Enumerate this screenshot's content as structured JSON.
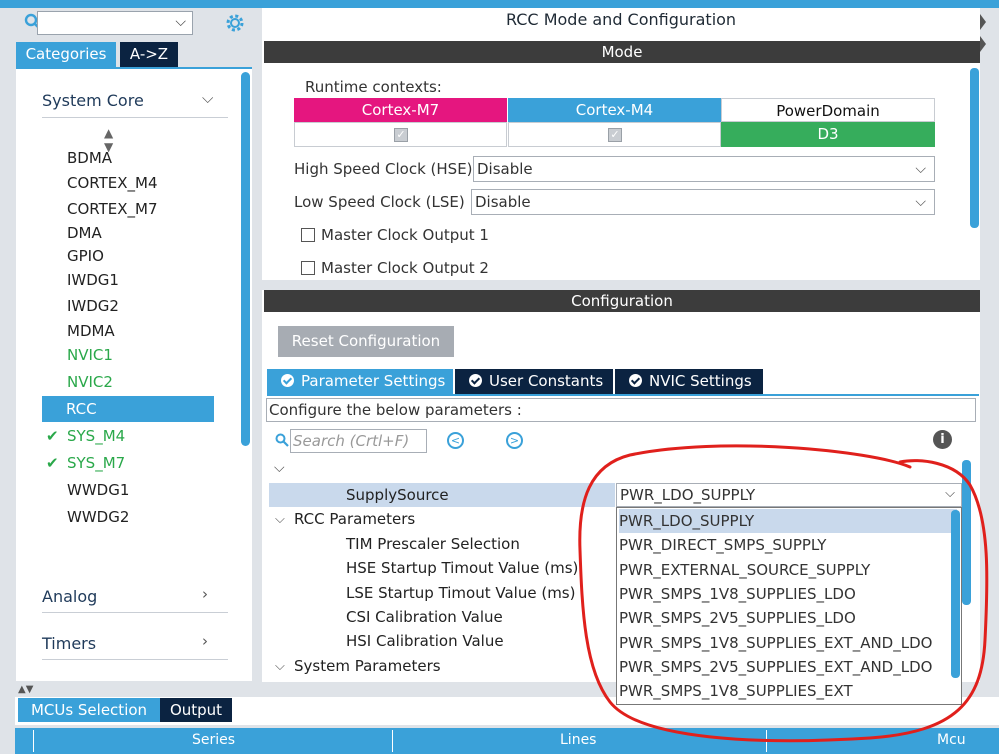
{
  "left_panel": {
    "search_placeholder": "",
    "tabs": {
      "categories": "Categories",
      "az": "A->Z"
    },
    "system_core": "System Core",
    "items": [
      {
        "label": "BDMA",
        "style": "normal"
      },
      {
        "label": "CORTEX_M4",
        "style": "normal"
      },
      {
        "label": "CORTEX_M7",
        "style": "normal"
      },
      {
        "label": "DMA",
        "style": "normal"
      },
      {
        "label": "GPIO",
        "style": "normal"
      },
      {
        "label": "IWDG1",
        "style": "normal"
      },
      {
        "label": "IWDG2",
        "style": "normal"
      },
      {
        "label": "MDMA",
        "style": "normal"
      },
      {
        "label": "NVIC1",
        "style": "green"
      },
      {
        "label": "NVIC2",
        "style": "green"
      },
      {
        "label": "RCC",
        "style": "selected"
      },
      {
        "label": "SYS_M4",
        "style": "green-check"
      },
      {
        "label": "SYS_M7",
        "style": "green-check"
      },
      {
        "label": "WWDG1",
        "style": "normal"
      },
      {
        "label": "WWDG2",
        "style": "normal"
      }
    ],
    "analog": "Analog",
    "timers": "Timers"
  },
  "bottom": {
    "tabs": {
      "mcu": "MCUs Selection",
      "output": "Output"
    },
    "columns": {
      "series": "Series",
      "lines": "Lines",
      "mcu": "Mcu"
    }
  },
  "rcc": {
    "title": "RCC Mode and Configuration",
    "mode_bar": "Mode",
    "config_bar": "Configuration",
    "runtime_label": "Runtime contexts:",
    "contexts": {
      "m7": "Cortex-M7",
      "m4": "Cortex-M4",
      "powerdomain": "PowerDomain",
      "d3": "D3"
    },
    "hse_label": "High Speed Clock (HSE)",
    "hse_value": "Disable",
    "lse_label": "Low Speed Clock (LSE)",
    "lse_value": "Disable",
    "mco1": "Master Clock Output 1",
    "mco2": "Master Clock Output 2",
    "reset_button": "Reset Configuration",
    "param_tabs": {
      "param": "Parameter Settings",
      "user": "User Constants",
      "nvic": "NVIC Settings"
    },
    "configure_text": "Configure the below parameters :",
    "search_placeholder": "Search (Crtl+F)",
    "supply_source_label": "SupplySource",
    "supply_source_value": "PWR_LDO_SUPPLY",
    "rcc_parameters": "RCC Parameters",
    "params": [
      "TIM Prescaler Selection",
      "HSE Startup Timout Value (ms)",
      "LSE Startup Timout Value (ms)",
      "CSI Calibration Value",
      "HSI Calibration Value"
    ],
    "system_parameters": "System Parameters",
    "dropdown_options": [
      "PWR_LDO_SUPPLY",
      "PWR_DIRECT_SMPS_SUPPLY",
      "PWR_EXTERNAL_SOURCE_SUPPLY",
      "PWR_SMPS_1V8_SUPPLIES_LDO",
      "PWR_SMPS_2V5_SUPPLIES_LDO",
      "PWR_SMPS_1V8_SUPPLIES_EXT_AND_LDO",
      "PWR_SMPS_2V5_SUPPLIES_EXT_AND_LDO",
      "PWR_SMPS_1V8_SUPPLIES_EXT"
    ]
  },
  "colors": {
    "accent": "#3aa1d9",
    "dark_tab": "#0b2341",
    "cortex_m7": "#e5167f",
    "d3_green": "#36ad5c",
    "annotation_red": "#e0201c"
  }
}
